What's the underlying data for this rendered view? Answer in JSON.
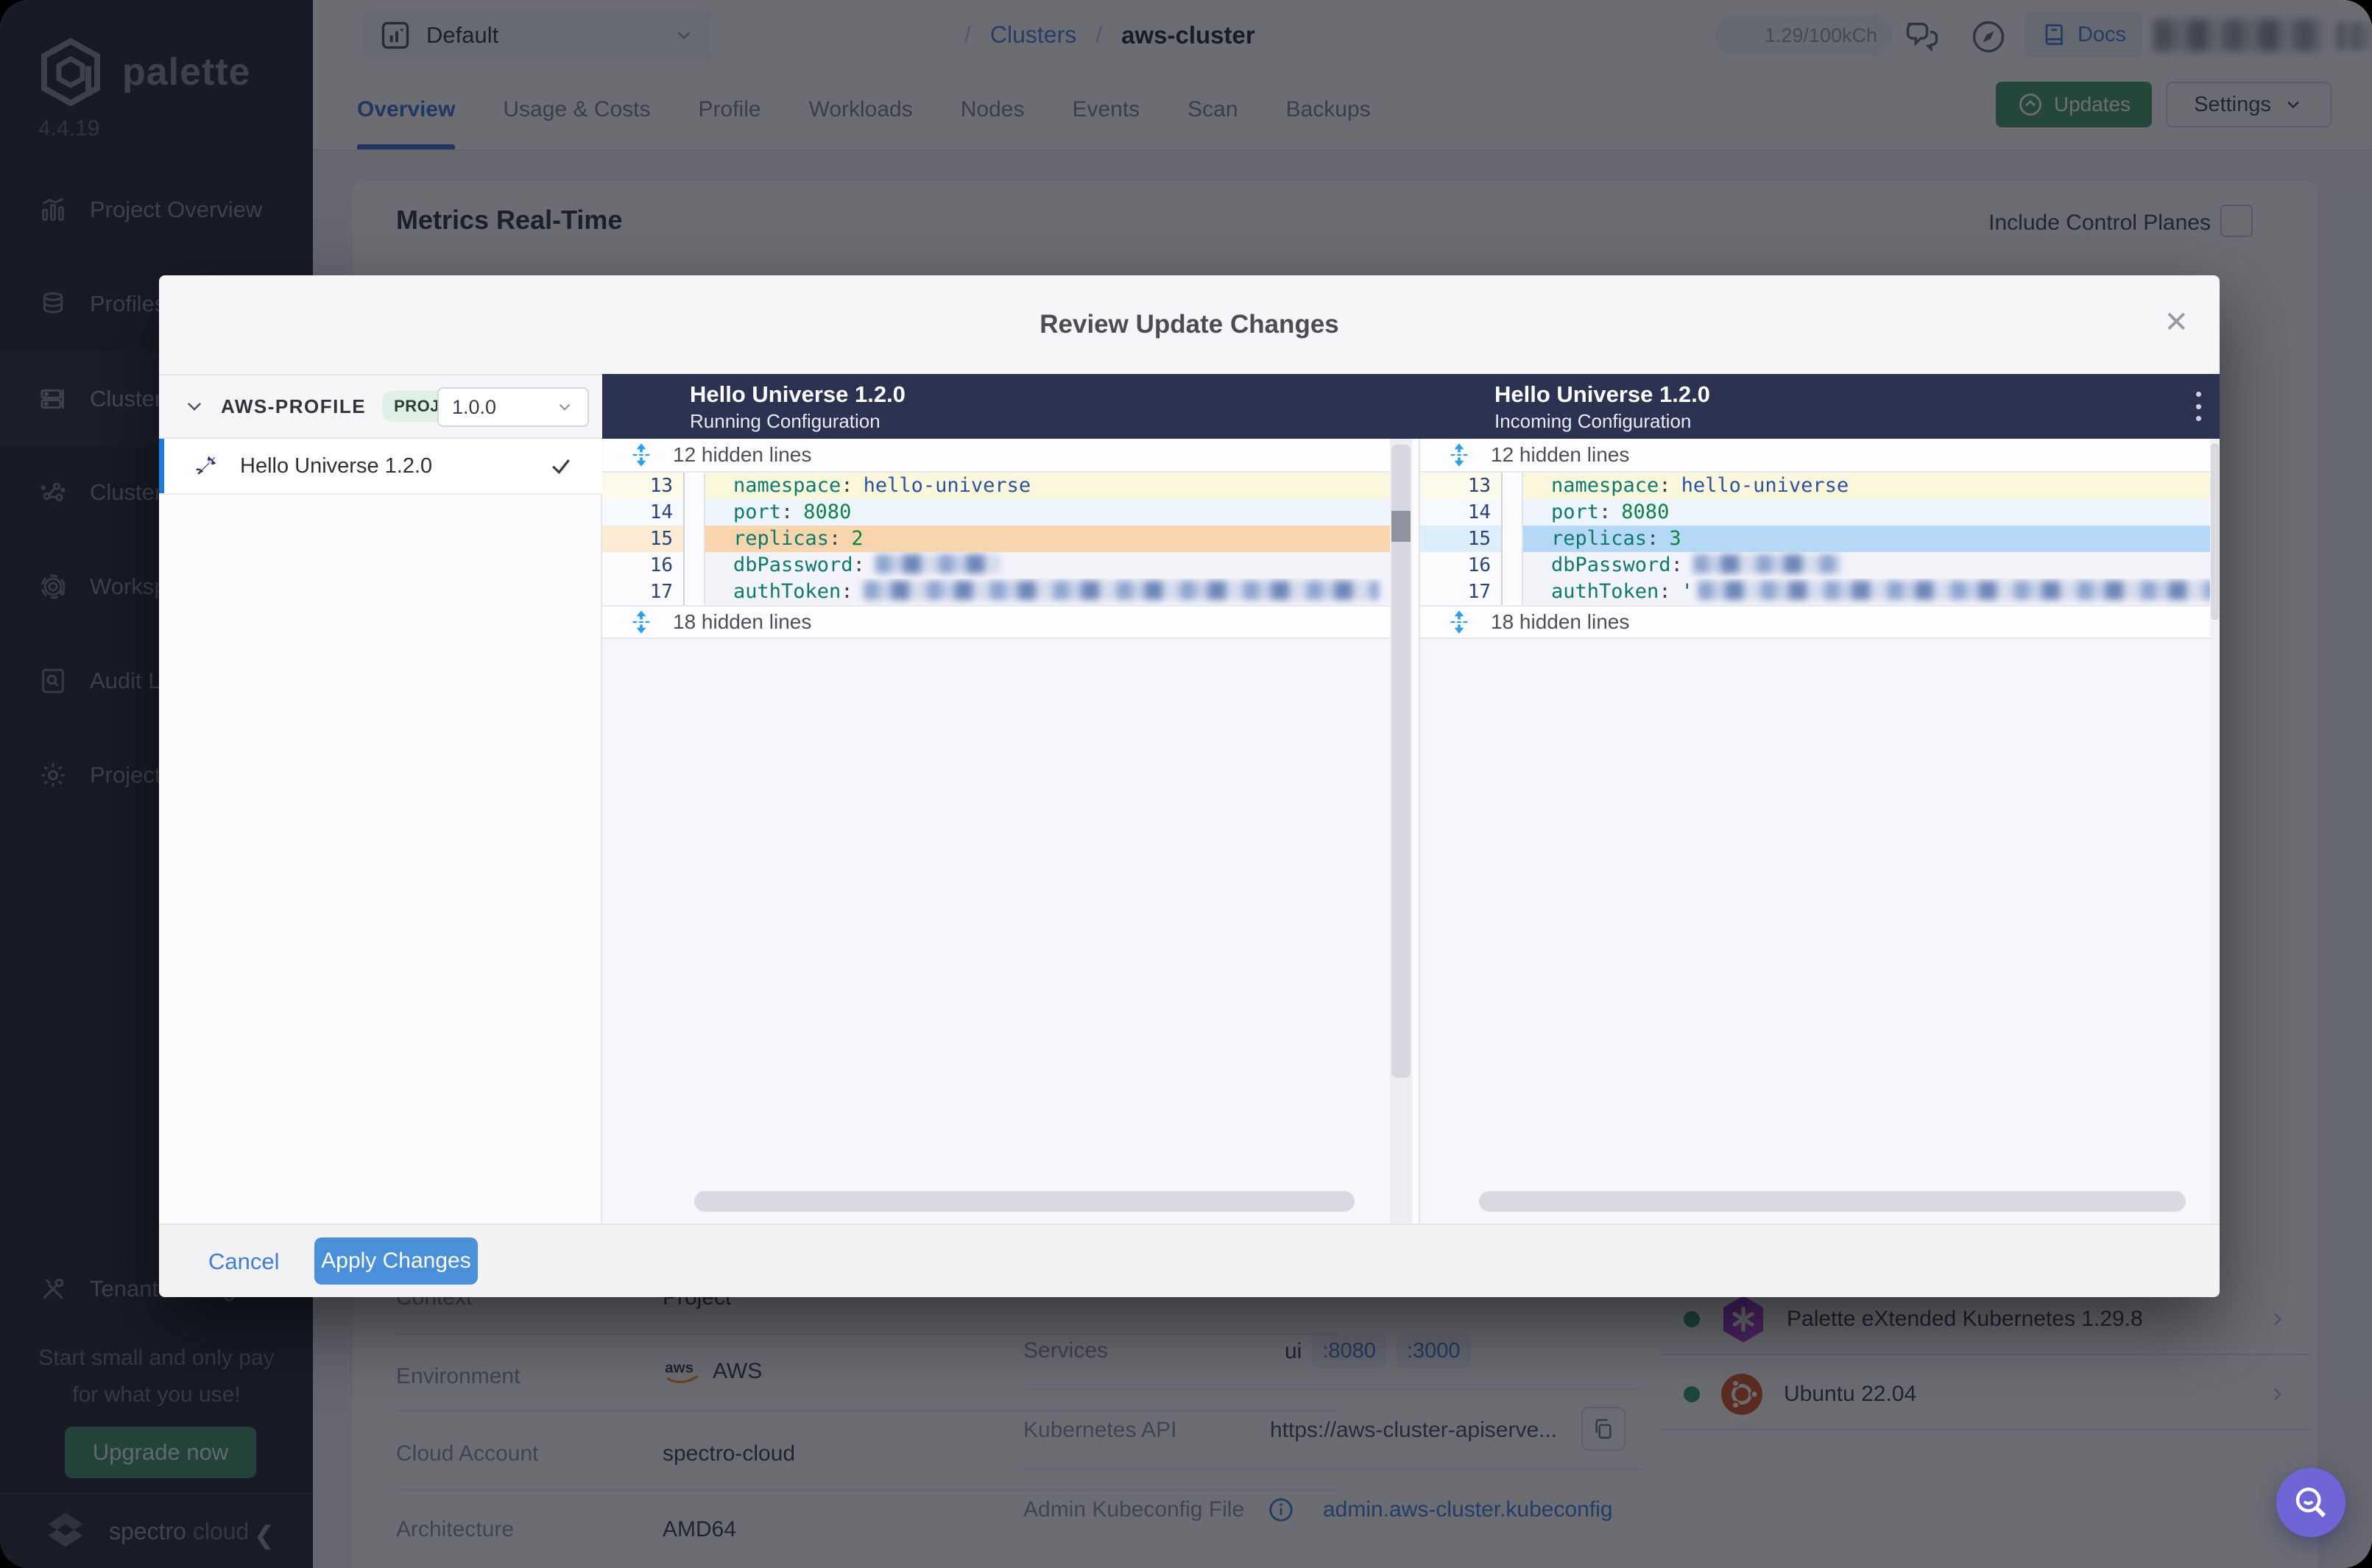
{
  "app": {
    "brand": "palette",
    "version": "4.4.19"
  },
  "sidebar": {
    "items": [
      {
        "label": "Project Overview"
      },
      {
        "label": "Profiles"
      },
      {
        "label": "Clusters"
      },
      {
        "label": "Cluster Groups"
      },
      {
        "label": "Workspaces"
      },
      {
        "label": "Audit Logs"
      },
      {
        "label": "Project Settings"
      },
      {
        "label": "Tenant Settings"
      }
    ],
    "upsell": {
      "line1": "Start small and only pay",
      "line2": "for what you use!",
      "button": "Upgrade now"
    },
    "brand_footer_1": "spectro",
    "brand_footer_2": "cloud"
  },
  "header": {
    "project": "Default",
    "breadcrumb_sep": "/",
    "breadcrumb_root": "Clusters",
    "breadcrumb_current": "aws-cluster",
    "usage": "1.29/100kCh",
    "docs": "Docs"
  },
  "tabs": {
    "items": [
      "Overview",
      "Usage & Costs",
      "Profile",
      "Workloads",
      "Nodes",
      "Events",
      "Scan",
      "Backups"
    ],
    "active": "Overview",
    "updates": "Updates",
    "settings": "Settings"
  },
  "overview": {
    "title": "Metrics Real-Time",
    "control_planes": "Include Control Planes",
    "details": [
      {
        "label": "Context",
        "value": "Project"
      },
      {
        "label": "Environment",
        "value": "AWS"
      },
      {
        "label": "Cloud Account",
        "value": "spectro-cloud"
      },
      {
        "label": "Architecture",
        "value": "AMD64"
      }
    ],
    "services": {
      "label": "Services",
      "name": "ui",
      "port1": ":8080",
      "port2": ":3000"
    },
    "kube_api": {
      "label": "Kubernetes API",
      "value": "https://aws-cluster-apiserve..."
    },
    "kubeconfig": {
      "label": "Admin Kubeconfig File",
      "value": "admin.aws-cluster.kubeconfig"
    },
    "packs": [
      {
        "name": "Palette eXtended Kubernetes 1.29.8"
      },
      {
        "name": "Ubuntu 22.04"
      }
    ]
  },
  "modal": {
    "title": "Review Update Changes",
    "profile": {
      "name": "AWS-PROFILE",
      "scope": "PROJ",
      "version": "1.0.0",
      "item": "Hello Universe 1.2.0"
    },
    "left_header": {
      "title": "Hello Universe 1.2.0",
      "subtitle": "Running Configuration"
    },
    "right_header": {
      "title": "Hello Universe 1.2.0",
      "subtitle": "Incoming Configuration"
    },
    "hidden_top": "12 hidden lines",
    "hidden_bottom": "18 hidden lines",
    "code": {
      "colon": ":",
      "l13": {
        "no": "13",
        "key": "namespace",
        "value": "hello-universe"
      },
      "l14": {
        "no": "14",
        "key": "port",
        "value": "8080"
      },
      "l15": {
        "no": "15",
        "key": "replicas",
        "left_value": "2",
        "right_value": "3"
      },
      "l16": {
        "no": "16",
        "key": "dbPassword"
      },
      "l17": {
        "no": "17",
        "key": "authToken",
        "right_quote": "'"
      }
    },
    "cancel": "Cancel",
    "apply": "Apply Changes"
  },
  "colors": {
    "accent_blue": "#4a90d9",
    "brand_green": "#42996c",
    "diff_header_navy": "#2c3252",
    "diff_removed_bg": "#f9d5ae",
    "diff_added_bg": "#b5d8f6",
    "status_green": "#2f9e6e"
  }
}
